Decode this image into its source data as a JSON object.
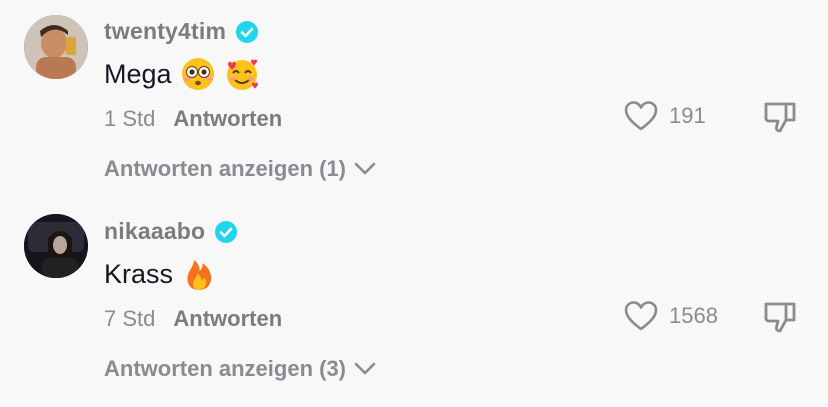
{
  "comments": [
    {
      "username": "twenty4tim",
      "text": "Mega",
      "emojis": [
        "flushed-face",
        "smiling-face-with-hearts"
      ],
      "time": "1 Std",
      "reply_label": "Antworten",
      "likes": "191",
      "view_replies": "Antworten anzeigen (1)"
    },
    {
      "username": "nikaaabo",
      "text": "Krass",
      "emojis": [
        "fire"
      ],
      "time": "7 Std",
      "reply_label": "Antworten",
      "likes": "1568",
      "view_replies": "Antworten anzeigen (3)"
    }
  ],
  "colors": {
    "background": "#f8f8f8",
    "verified": "#20d5ec",
    "username": "#7b7b80",
    "text": "#161823",
    "secondary": "#8a8b91"
  }
}
